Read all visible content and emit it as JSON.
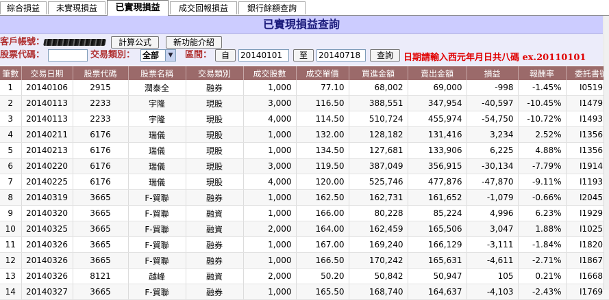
{
  "tabs": [
    {
      "label": "綜合損益",
      "active": false
    },
    {
      "label": "未實現損益",
      "active": false
    },
    {
      "label": "已實現損益",
      "active": true
    },
    {
      "label": "成交回報損益",
      "active": false
    },
    {
      "label": "銀行餘額查詢",
      "active": false
    }
  ],
  "page_title": "已實現損益查詢",
  "form": {
    "account_label": "客戶帳號：",
    "calc_formula_button": "計算公式",
    "new_features_button": "新功能介紹",
    "stock_code_label": "股票代碼：",
    "stock_code_value": "",
    "trade_type_label": "交易類別：",
    "trade_type_selected": "全部",
    "period_label": "區間：",
    "from_button": "自",
    "from_date": "20140101",
    "to_button": "至",
    "to_date": "20140718",
    "query_button": "查詢",
    "date_note": "日期請輸入西元年月日共八碼 ex.20110101"
  },
  "table": {
    "headers": [
      "筆數",
      "交易日期",
      "股票代碼",
      "股票名稱",
      "交易類別",
      "成交股數",
      "成交單價",
      "買進金額",
      "賣出金額",
      "損益",
      "報酬率",
      "委託書號"
    ],
    "rows": [
      [
        "1",
        "20140106",
        "2915",
        "潤泰全",
        "融券",
        "1,000",
        "77.10",
        "68,002",
        "69,000",
        "-998",
        "-1.45%",
        "I0519"
      ],
      [
        "2",
        "20140113",
        "2233",
        "宇隆",
        "現股",
        "3,000",
        "116.50",
        "388,551",
        "347,954",
        "-40,597",
        "-10.45%",
        "I1479"
      ],
      [
        "3",
        "20140113",
        "2233",
        "宇隆",
        "現股",
        "4,000",
        "114.50",
        "510,724",
        "455,974",
        "-54,750",
        "-10.72%",
        "I1493"
      ],
      [
        "4",
        "20140211",
        "6176",
        "瑞儀",
        "現股",
        "1,000",
        "132.00",
        "128,182",
        "131,416",
        "3,234",
        "2.52%",
        "I1356"
      ],
      [
        "5",
        "20140213",
        "6176",
        "瑞儀",
        "現股",
        "1,000",
        "134.50",
        "127,681",
        "133,906",
        "6,225",
        "4.88%",
        "I1356"
      ],
      [
        "6",
        "20140220",
        "6176",
        "瑞儀",
        "現股",
        "3,000",
        "119.50",
        "387,049",
        "356,915",
        "-30,134",
        "-7.79%",
        "I1914"
      ],
      [
        "7",
        "20140225",
        "6176",
        "瑞儀",
        "現股",
        "4,000",
        "120.00",
        "525,746",
        "477,876",
        "-47,870",
        "-9.11%",
        "I1193"
      ],
      [
        "8",
        "20140319",
        "3665",
        "F-貿聯",
        "融券",
        "1,000",
        "162.50",
        "162,731",
        "161,652",
        "-1,079",
        "-0.66%",
        "I2045"
      ],
      [
        "9",
        "20140320",
        "3665",
        "F-貿聯",
        "融資",
        "1,000",
        "166.00",
        "80,228",
        "85,224",
        "4,996",
        "6.23%",
        "I1929"
      ],
      [
        "10",
        "20140325",
        "3665",
        "F-貿聯",
        "融資",
        "2,000",
        "164.00",
        "162,459",
        "165,506",
        "3,047",
        "1.88%",
        "I1025"
      ],
      [
        "11",
        "20140326",
        "3665",
        "F-貿聯",
        "融券",
        "1,000",
        "167.00",
        "169,240",
        "166,129",
        "-3,111",
        "-1.84%",
        "I1820"
      ],
      [
        "12",
        "20140326",
        "3665",
        "F-貿聯",
        "融券",
        "1,000",
        "166.50",
        "170,242",
        "165,631",
        "-4,611",
        "-2.71%",
        "I1867"
      ],
      [
        "13",
        "20140326",
        "8121",
        "越峰",
        "融資",
        "2,000",
        "50.20",
        "50,842",
        "50,947",
        "105",
        "0.21%",
        "I1668"
      ],
      [
        "14",
        "20140327",
        "3665",
        "F-貿聯",
        "融券",
        "1,000",
        "165.50",
        "168,740",
        "164,637",
        "-4,103",
        "-2.43%",
        "I1769"
      ]
    ]
  },
  "colors": {
    "header_bg": "#9b6a6a",
    "title_bg": "#ccccff",
    "title_text": "#1a1a7a",
    "label_red": "#b03030",
    "note_red": "#e00000"
  }
}
